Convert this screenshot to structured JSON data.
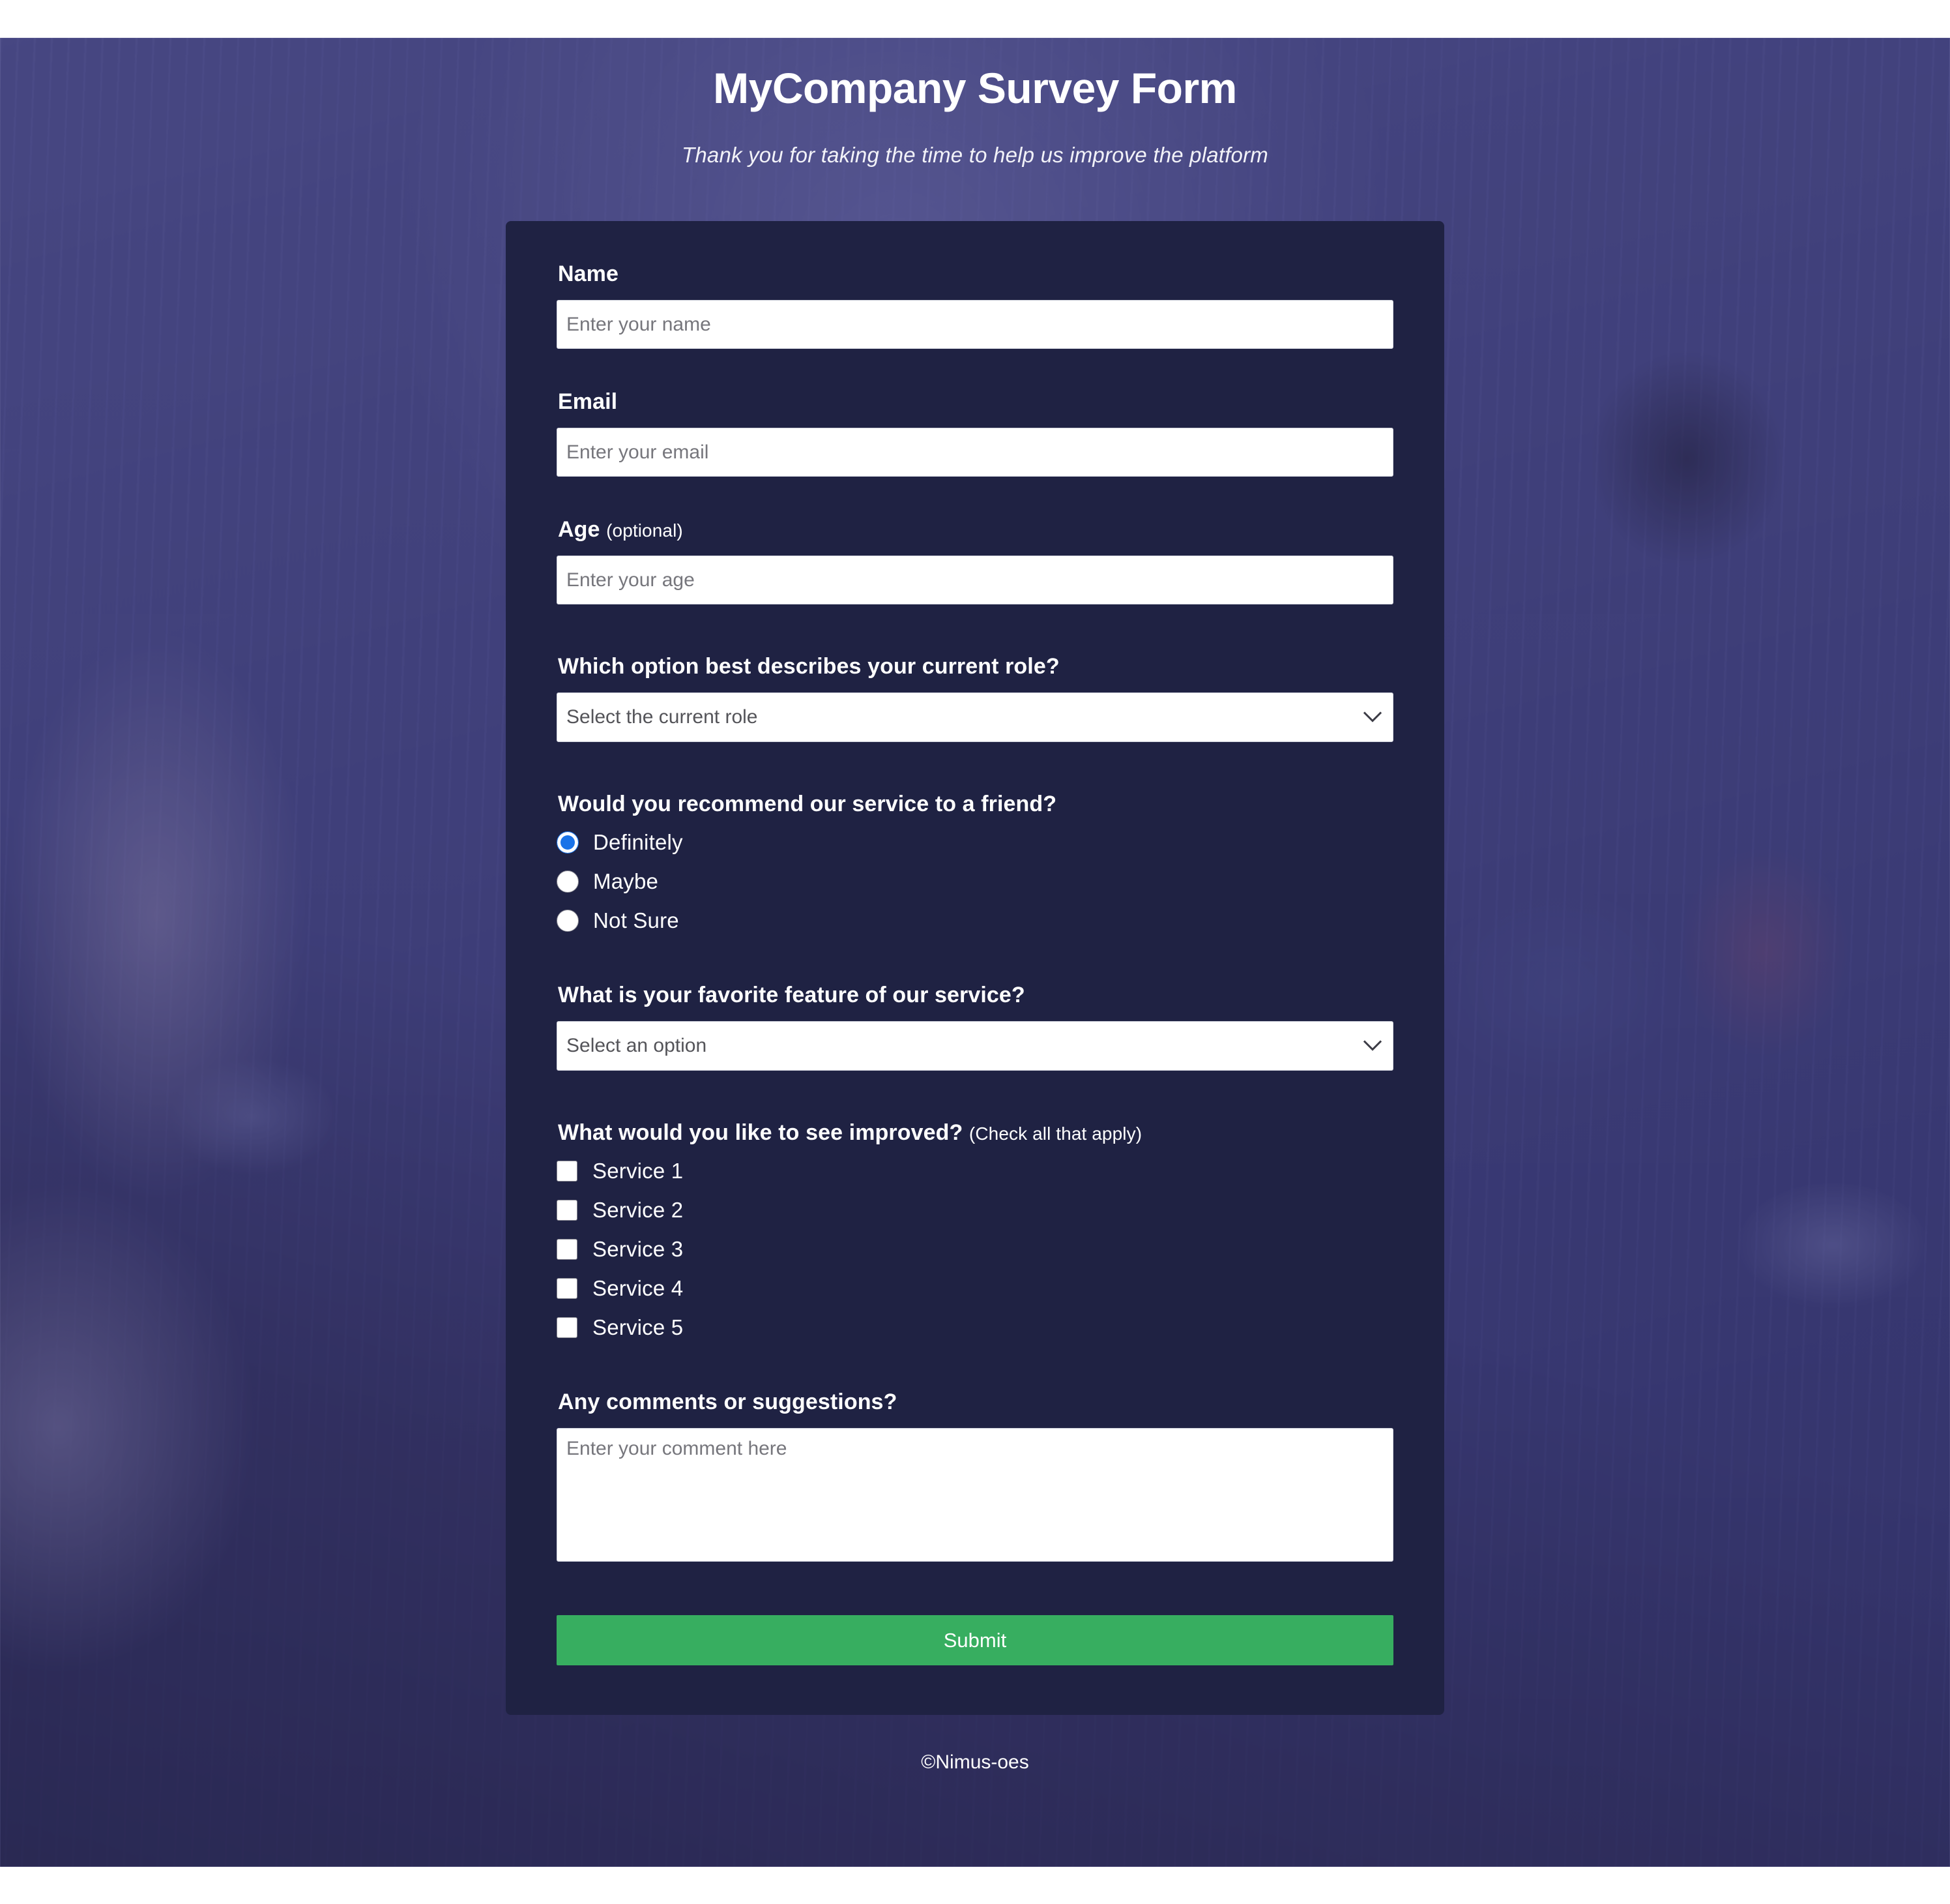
{
  "header": {
    "title": "MyCompany Survey Form",
    "subtitle": "Thank you for taking the time to help us improve the platform"
  },
  "form": {
    "name": {
      "label": "Name",
      "placeholder": "Enter your name",
      "value": ""
    },
    "email": {
      "label": "Email",
      "placeholder": "Enter your email",
      "value": ""
    },
    "age": {
      "label": "Age",
      "label_suffix": "(optional)",
      "placeholder": "Enter your age",
      "value": ""
    },
    "role": {
      "label": "Which option best describes your current role?",
      "selected": "Select the current role",
      "icon": "chevron-down-icon"
    },
    "recommend": {
      "label": "Would you recommend our service to a friend?",
      "options": [
        {
          "label": "Definitely",
          "checked": true
        },
        {
          "label": "Maybe",
          "checked": false
        },
        {
          "label": "Not Sure",
          "checked": false
        }
      ]
    },
    "favorite_feature": {
      "label": "What is your favorite feature of our service?",
      "selected": "Select an option",
      "icon": "chevron-down-icon"
    },
    "improvements": {
      "label": "What would you like to see improved?",
      "label_suffix": "(Check all that apply)",
      "options": [
        {
          "label": "Service 1",
          "checked": false
        },
        {
          "label": "Service 2",
          "checked": false
        },
        {
          "label": "Service 3",
          "checked": false
        },
        {
          "label": "Service 4",
          "checked": false
        },
        {
          "label": "Service 5",
          "checked": false
        }
      ]
    },
    "comments": {
      "label": "Any comments or suggestions?",
      "placeholder": "Enter your comment here",
      "value": ""
    },
    "submit_label": "Submit"
  },
  "footer": {
    "copyright": "©Nimus-oes"
  },
  "colors": {
    "card_background": "#1f2243",
    "page_tint": "#56569 6",
    "submit_green": "#37ae60",
    "radio_accent": "#1a73e8",
    "text_white": "#ffffff"
  }
}
